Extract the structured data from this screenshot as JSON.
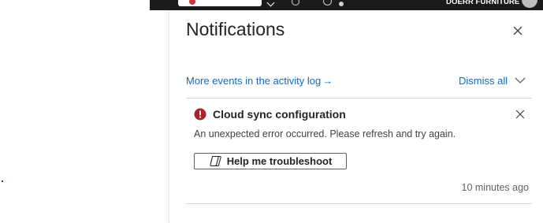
{
  "topbar": {
    "org_name": "DOERR FURNITURE"
  },
  "panel": {
    "title": "Notifications",
    "activity_link": "More events in the activity log",
    "activity_link_arrow": "→",
    "dismiss_all": "Dismiss all"
  },
  "notification": {
    "status": "error",
    "status_color": "#a4262c",
    "title": "Cloud sync configuration",
    "message": "An unexpected error occurred. Please refresh and try again.",
    "action_label": "Help me troubleshoot",
    "action_icon": "copilot-icon",
    "timestamp": "10 minutes ago"
  },
  "colors": {
    "link": "#0f6cbd",
    "topbar": "#1b1b1b"
  }
}
